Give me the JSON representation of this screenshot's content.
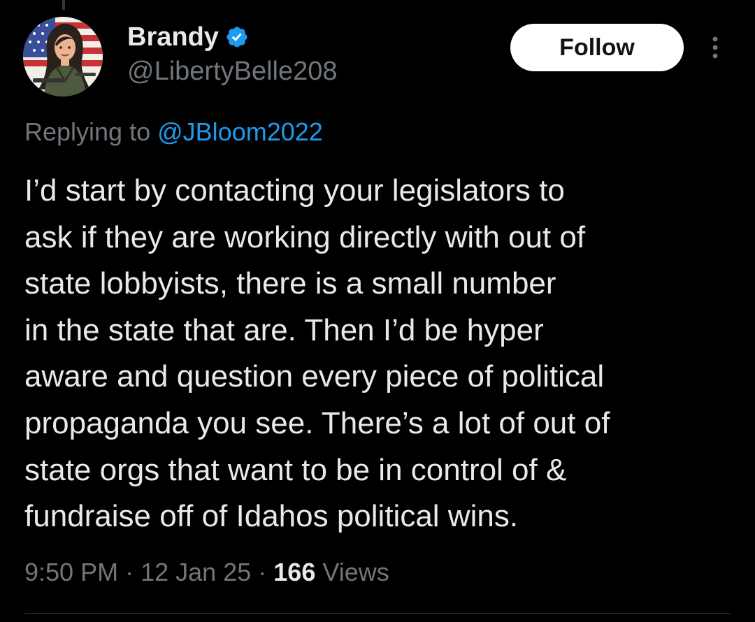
{
  "author": {
    "display_name": "Brandy",
    "handle": "@LibertyBelle208",
    "avatar_icon": "avatar-image",
    "verified_icon": "verified-badge-icon"
  },
  "actions": {
    "follow_label": "Follow",
    "more_icon": "more-options-icon"
  },
  "reply": {
    "prefix": "Replying to",
    "mention": "@JBloom2022"
  },
  "tweet": {
    "lines": [
      "I’d start by contacting your legislators to",
      "ask if they are working directly with out of",
      "state lobbyists, there is a small number",
      "in the state that are. Then I’d be hyper",
      "aware and question every piece of political",
      "propaganda you see. There’s a lot of out of",
      "state orgs that want to be in control of &",
      "fundraise off of Idahos political wins."
    ]
  },
  "meta": {
    "time": "9:50 PM",
    "separator": "·",
    "date": "12 Jan 25",
    "views_count": "166",
    "views_label": "Views"
  },
  "colors": {
    "background": "#000000",
    "primary_text": "#e7e9ea",
    "secondary_text": "#71767b",
    "accent_blue": "#1d9bf0",
    "follow_bg": "#ffffff"
  }
}
